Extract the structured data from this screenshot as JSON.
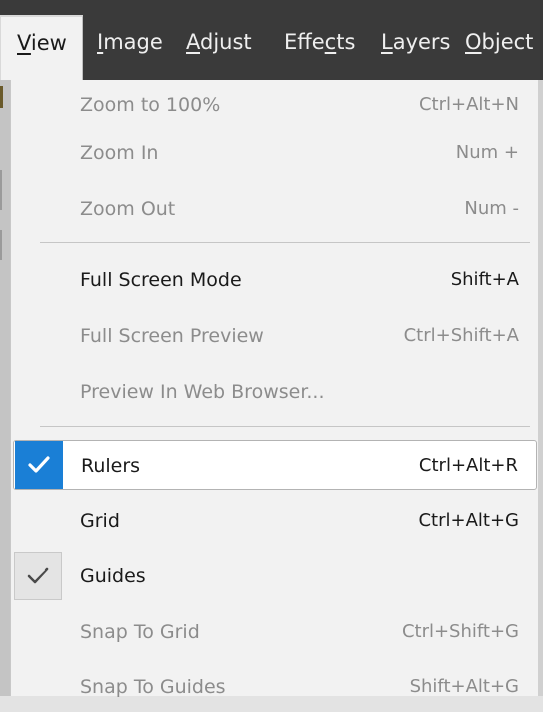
{
  "menubar": {
    "items": [
      {
        "label": "View",
        "accel": "V",
        "rest": "iew",
        "active": true
      },
      {
        "label": "Image",
        "accel": "I",
        "rest": "mage"
      },
      {
        "label": "Adjust",
        "accel": "A",
        "rest": "djust"
      },
      {
        "label": "Effects",
        "pre": "Effe",
        "accel": "c",
        "rest": "ts"
      },
      {
        "label": "Layers",
        "accel": "L",
        "rest": "ayers"
      },
      {
        "label": "Object",
        "accel": "O",
        "rest": "bject"
      }
    ]
  },
  "view_menu": {
    "items": [
      {
        "label": "Zoom to 100%",
        "shortcut": "Ctrl+Alt+N",
        "enabled": false
      },
      {
        "label": "Zoom In",
        "shortcut": "Num +",
        "enabled": false
      },
      {
        "label": "Zoom Out",
        "shortcut": "Num -",
        "enabled": false
      },
      {
        "label": "Full Screen Mode",
        "shortcut": "Shift+A",
        "enabled": true
      },
      {
        "label": "Full Screen Preview",
        "shortcut": "Ctrl+Shift+A",
        "enabled": false
      },
      {
        "label": "Preview In Web Browser...",
        "shortcut": "",
        "enabled": false
      },
      {
        "label": "Rulers",
        "shortcut": "Ctrl+Alt+R",
        "enabled": true,
        "checked": true,
        "highlighted": true
      },
      {
        "label": "Grid",
        "shortcut": "Ctrl+Alt+G",
        "enabled": true
      },
      {
        "label": "Guides",
        "shortcut": "",
        "enabled": true,
        "checked": true
      },
      {
        "label": "Snap To Grid",
        "shortcut": "Ctrl+Shift+G",
        "enabled": false
      },
      {
        "label": "Snap To Guides",
        "shortcut": "Shift+Alt+G",
        "enabled": false
      }
    ]
  },
  "colors": {
    "menubar_bg": "#3a3a3a",
    "dropdown_bg": "#f2f2f2",
    "check_accent": "#1a7fd6"
  }
}
